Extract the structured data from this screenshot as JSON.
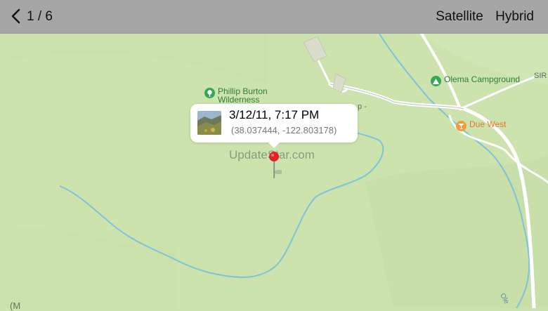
{
  "toolbar": {
    "page_counter": "1 / 6",
    "satellite_label": "Satellite",
    "hybrid_label": "Hybrid"
  },
  "map": {
    "pois": {
      "phillip_burton": "Phillip Burton\nWilderness",
      "olema_campground": "Olema Campground",
      "due_west": "Due West"
    },
    "road_label_partial": "SIR",
    "road_fragment": "p -",
    "river_label_partial": "Ole",
    "bottom_left_fragment": "(M"
  },
  "callout": {
    "title": "3/12/11, 7:17 PM",
    "coordinates": "(38.037444, -122.803178)"
  },
  "watermark": "UpdateStar.com",
  "colors": {
    "land": "#cde3ae",
    "toolbar": "#a6a6a6",
    "road": "#ffffff",
    "river": "#7fc3d9",
    "pin": "#e02323"
  }
}
